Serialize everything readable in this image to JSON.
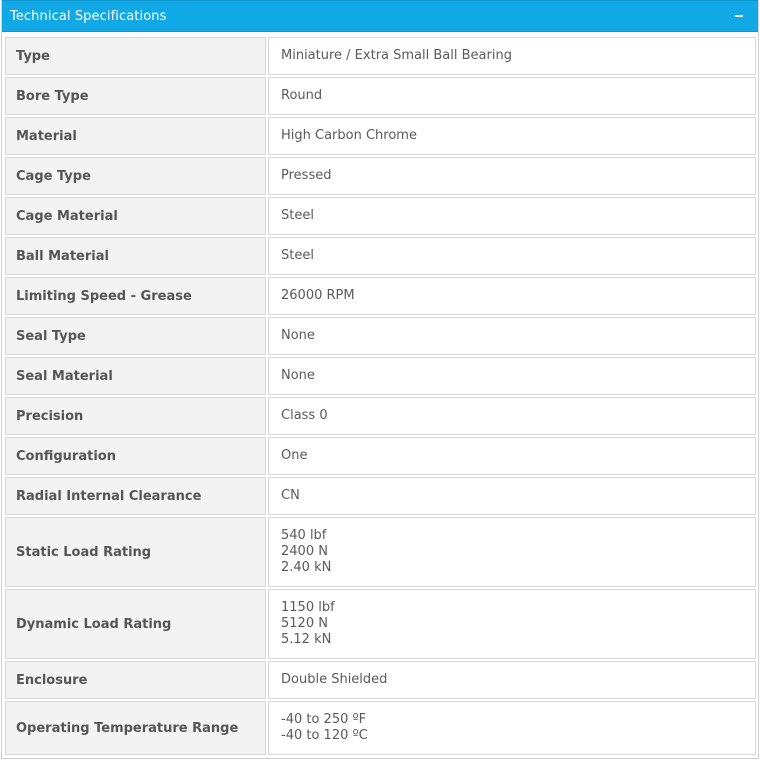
{
  "panel": {
    "title": "Technical Specifications",
    "toggle_icon": "minus-icon"
  },
  "specs": [
    {
      "label": "Type",
      "values": [
        "Miniature / Extra Small Ball Bearing"
      ]
    },
    {
      "label": "Bore Type",
      "values": [
        "Round"
      ]
    },
    {
      "label": "Material",
      "values": [
        "High Carbon Chrome"
      ]
    },
    {
      "label": "Cage Type",
      "values": [
        "Pressed"
      ]
    },
    {
      "label": "Cage Material",
      "values": [
        "Steel"
      ]
    },
    {
      "label": "Ball Material",
      "values": [
        "Steel"
      ]
    },
    {
      "label": "Limiting Speed - Grease",
      "values": [
        "26000 RPM"
      ]
    },
    {
      "label": "Seal Type",
      "values": [
        "None"
      ]
    },
    {
      "label": "Seal Material",
      "values": [
        "None"
      ]
    },
    {
      "label": "Precision",
      "values": [
        "Class 0"
      ]
    },
    {
      "label": "Configuration",
      "values": [
        "One"
      ]
    },
    {
      "label": "Radial Internal Clearance",
      "values": [
        "CN"
      ]
    },
    {
      "label": "Static Load Rating",
      "values": [
        "540 lbf",
        "2400 N",
        "2.40 kN"
      ]
    },
    {
      "label": "Dynamic Load Rating",
      "values": [
        "1150 lbf",
        "5120 N",
        "5.12 kN"
      ]
    },
    {
      "label": "Enclosure",
      "values": [
        "Double Shielded"
      ]
    },
    {
      "label": "Operating Temperature Range",
      "values": [
        "-40 to 250 ºF",
        "-40 to 120 ºC"
      ]
    }
  ]
}
